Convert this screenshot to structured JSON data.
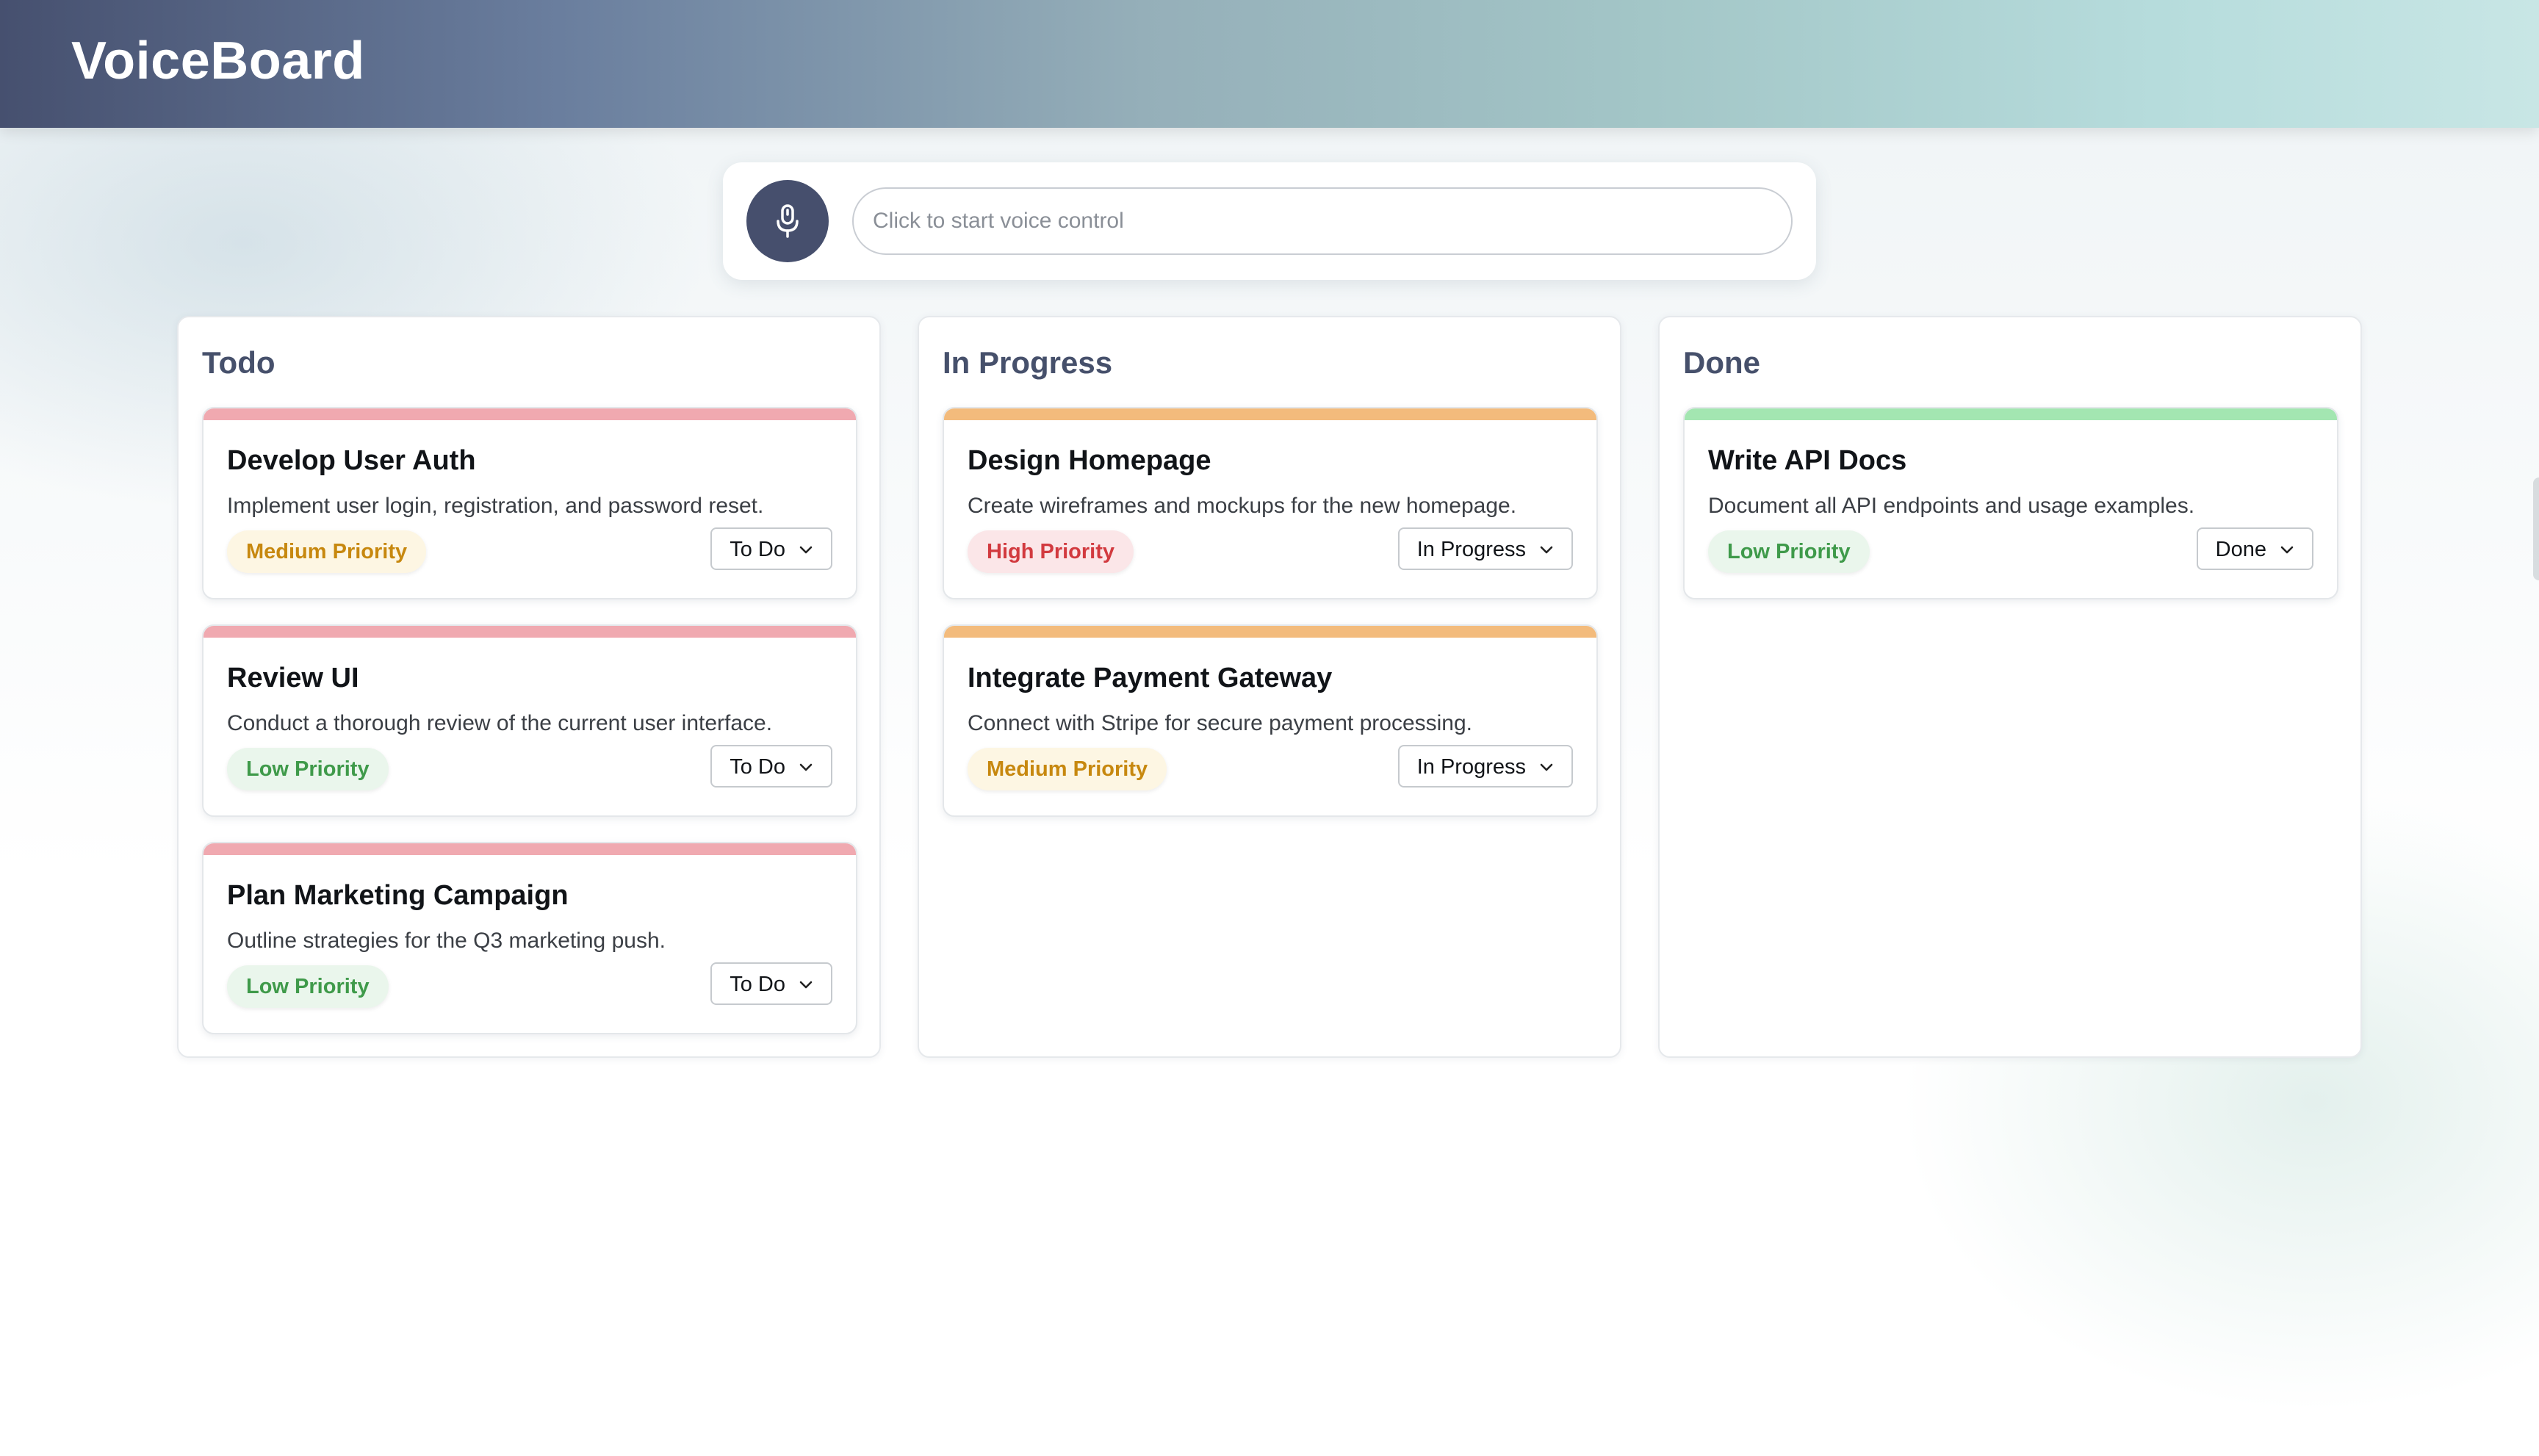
{
  "app": {
    "title": "VoiceBoard"
  },
  "voice": {
    "placeholder": "Click to start voice control",
    "mic_icon": "microphone-icon"
  },
  "columns": [
    {
      "title": "Todo",
      "cards": [
        {
          "title": "Develop User Auth",
          "description": "Implement user login, registration, and password reset.",
          "priority": "Medium Priority",
          "status": "To Do"
        },
        {
          "title": "Review UI",
          "description": "Conduct a thorough review of the current user interface.",
          "priority": "Low Priority",
          "status": "To Do"
        },
        {
          "title": "Plan Marketing Campaign",
          "description": "Outline strategies for the Q3 marketing push.",
          "priority": "Low Priority",
          "status": "To Do"
        }
      ]
    },
    {
      "title": "In Progress",
      "cards": [
        {
          "title": "Design Homepage",
          "description": "Create wireframes and mockups for the new homepage.",
          "priority": "High Priority",
          "status": "In Progress"
        },
        {
          "title": "Integrate Payment Gateway",
          "description": "Connect with Stripe for secure payment processing.",
          "priority": "Medium Priority",
          "status": "In Progress"
        }
      ]
    },
    {
      "title": "Done",
      "cards": [
        {
          "title": "Write API Docs",
          "description": "Document all API endpoints and usage examples.",
          "priority": "Low Priority",
          "status": "Done"
        }
      ]
    }
  ],
  "colors": {
    "stripe_todo": "#f0a9b0",
    "stripe_in_progress": "#f3bb7c",
    "stripe_done": "#a3e6b1",
    "mic_button": "#464f6d",
    "column_title": "#46506b"
  }
}
